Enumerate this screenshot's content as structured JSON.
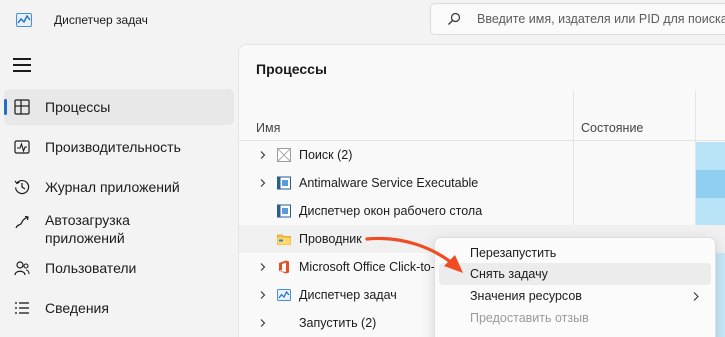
{
  "window": {
    "title": "Диспетчер задач",
    "icon": "task-manager-icon"
  },
  "search": {
    "placeholder": "Введите имя, издателя или PID для поиска"
  },
  "sidebar": {
    "items": [
      {
        "label": "Процессы",
        "icon": "processes-icon",
        "active": true
      },
      {
        "label": "Производительность",
        "icon": "performance-icon"
      },
      {
        "label": "Журнал приложений",
        "icon": "app-history-icon"
      },
      {
        "label": "Автозагрузка\nприложений",
        "label_line1": "Автозагрузка",
        "label_line2": "приложений",
        "icon": "startup-apps-icon"
      },
      {
        "label": "Пользователи",
        "icon": "users-icon"
      },
      {
        "label": "Сведения",
        "icon": "details-icon"
      }
    ]
  },
  "main": {
    "title": "Процессы",
    "columns": {
      "name": "Имя",
      "status": "Состояние"
    },
    "rows": [
      {
        "label": "Поиск (2)",
        "expandable": true,
        "icon": "search-process-icon"
      },
      {
        "label": "Antimalware Service Executable",
        "expandable": true,
        "icon": "antimalware-icon"
      },
      {
        "label": "Диспетчер окон рабочего стола",
        "expandable": false,
        "icon": "window-manager-icon"
      },
      {
        "label": "Проводник",
        "expandable": false,
        "icon": "folder-icon"
      },
      {
        "label": "Microsoft Office Click-to-Run",
        "expandable": true,
        "icon": "office-icon"
      },
      {
        "label": "Диспетчер задач",
        "expandable": true,
        "icon": "task-manager-icon"
      },
      {
        "label": "Запустить (2)",
        "expandable": true,
        "icon": ""
      }
    ],
    "heat_colors": [
      "#b9e3f7",
      "#8fd0f2",
      "#b9e3f7",
      "#c6e8f8"
    ]
  },
  "context_menu": {
    "items": [
      {
        "label": "Перезапустить",
        "enabled": true
      },
      {
        "label": "Снять задачу",
        "enabled": true,
        "highlighted": true
      },
      {
        "label": "Значения ресурсов",
        "enabled": true,
        "submenu": true
      },
      {
        "label": "Предоставить отзыв",
        "enabled": false
      }
    ]
  },
  "annotation": {
    "arrow_color": "#f04b23"
  }
}
